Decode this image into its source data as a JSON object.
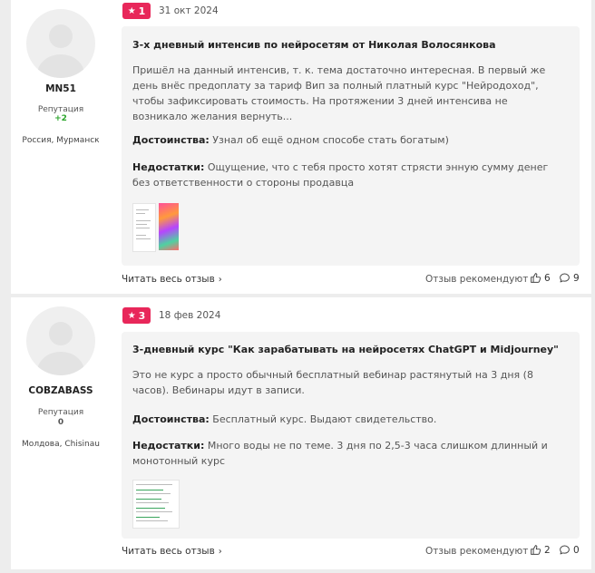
{
  "reviews": [
    {
      "rank": "1",
      "date": "31 окт 2024",
      "author": {
        "name": "MN51",
        "reputation_label": "Репутация",
        "reputation": "+2",
        "reputation_color": "#2aa52a",
        "city": "Россия, Мурманск"
      },
      "title": "3-х дневный интенсив по нейросетям от Николая Волосянкова",
      "text": "Пришёл на данный интенсив, т. к. тема достаточно интересная. В первый же день внёс предоплату за тариф Вип за полный платный курс \"Нейродоход\", чтобы зафиксировать стоимость. На протяжении 3 дней интенсива не возникало желания вернуть...",
      "pros_label": "Достоинства:",
      "pros": "Узнал об ещё одном способе стать богатым)",
      "cons_label": "Недостатки:",
      "cons": "Ощущение, что с тебя просто хотят стрясти энную сумму денег без ответственности о стороны продавца",
      "read_more": "Читать весь отзыв",
      "recommends": "Отзыв рекомендуют",
      "likes": "6",
      "comments": "9"
    },
    {
      "rank": "3",
      "date": "18 фев 2024",
      "author": {
        "name": "COBZABASS",
        "reputation_label": "Репутация",
        "reputation": "0",
        "reputation_color": "#555555",
        "city": "Молдова, Chisinau"
      },
      "title": "3-дневный курс \"Как зарабатывать на нейросетях ChatGPT и Midjourney\"",
      "text": "Это не курс а просто обычный бесплатный вебинар растянутый на 3 дня (8 часов). Вебинары идут в записи.",
      "pros_label": "Достоинства:",
      "pros": "Бесплатный курс. Выдают свидетельство.",
      "cons_label": "Недостатки:",
      "cons": "Много воды не по теме. 3 дня по 2,5-3 часа слишком длинный и монотонный курс",
      "read_more": "Читать весь отзыв",
      "recommends": "Отзыв рекомендуют",
      "likes": "2",
      "comments": "0"
    }
  ],
  "colors": {
    "badge": "#e8275a",
    "background": "#ededed",
    "card": "#f4f4f4"
  },
  "icons": {
    "badge": "star-icon",
    "read_more": "chevron-right-icon",
    "likes": "thumbs-up-icon",
    "comments": "comment-icon"
  }
}
